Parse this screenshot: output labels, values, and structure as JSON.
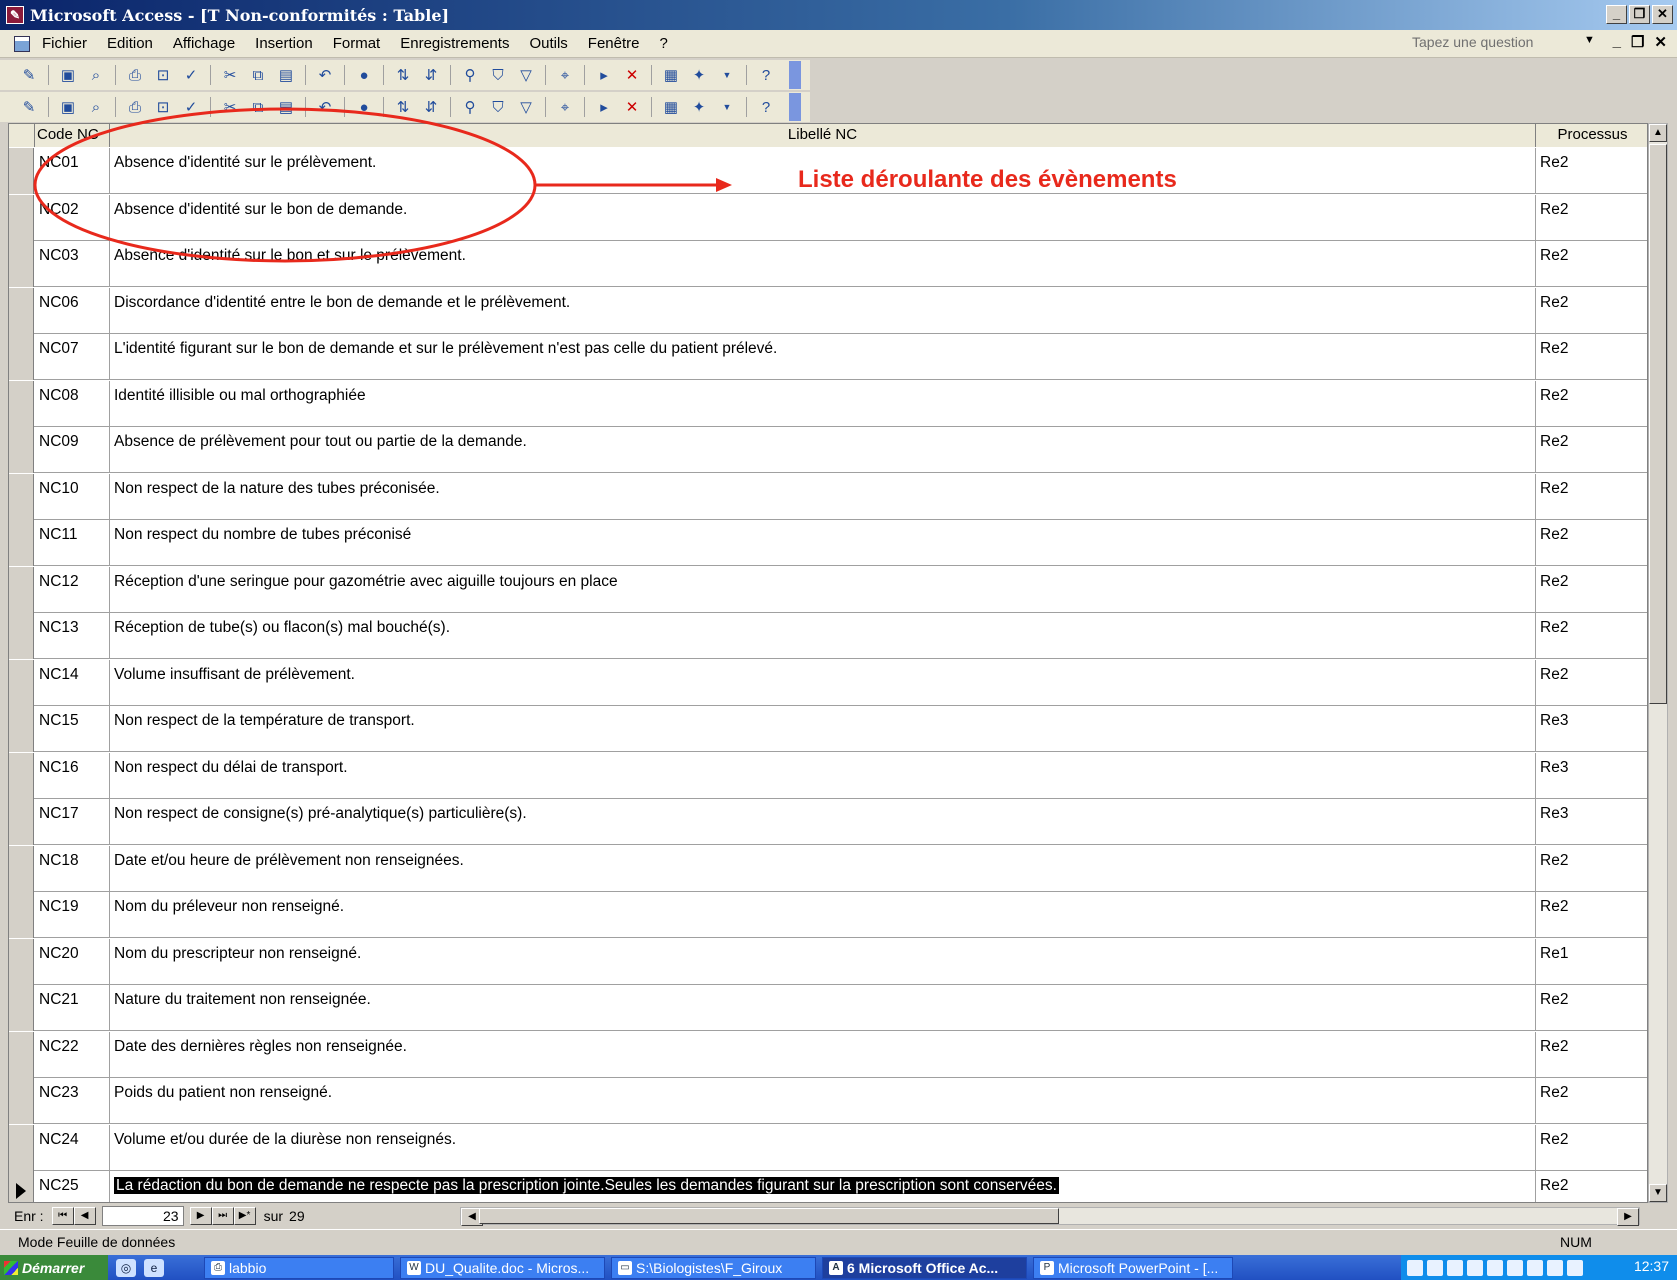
{
  "window": {
    "title": "Microsoft Access - [T Non-conformités : Table]",
    "minimize": "_",
    "restore": "❐",
    "close": "✕"
  },
  "menu": {
    "items": [
      "Fichier",
      "Edition",
      "Affichage",
      "Insertion",
      "Format",
      "Enregistrements",
      "Outils",
      "Fenêtre",
      "?"
    ],
    "ask_placeholder": "Tapez une question"
  },
  "table": {
    "columns": [
      "Code NC",
      "Libellé NC",
      "Processus"
    ],
    "rows": [
      {
        "code": "NC01",
        "libelle": "Absence d'identité sur le prélèvement.",
        "processus": "Re2"
      },
      {
        "code": "NC02",
        "libelle": "Absence d'identité sur le bon de demande.",
        "processus": "Re2"
      },
      {
        "code": "NC03",
        "libelle": "Absence d'identité sur le bon et sur le prélèvement.",
        "processus": "Re2"
      },
      {
        "code": "NC06",
        "libelle": "Discordance d'identité entre le bon de demande et le prélèvement.",
        "processus": "Re2"
      },
      {
        "code": "NC07",
        "libelle": "L'identité figurant sur le bon de demande et sur le prélèvement n'est pas celle du patient prélevé.",
        "processus": "Re2"
      },
      {
        "code": "NC08",
        "libelle": "Identité illisible ou mal orthographiée",
        "processus": "Re2"
      },
      {
        "code": "NC09",
        "libelle": "Absence de prélèvement pour tout ou partie de la demande.",
        "processus": "Re2"
      },
      {
        "code": "NC10",
        "libelle": "Non respect de la nature des tubes préconisée.",
        "processus": "Re2"
      },
      {
        "code": "NC11",
        "libelle": "Non respect du nombre de tubes préconisé",
        "processus": "Re2"
      },
      {
        "code": "NC12",
        "libelle": "Réception d'une seringue pour gazométrie avec aiguille toujours en place",
        "processus": "Re2"
      },
      {
        "code": "NC13",
        "libelle": "Réception de tube(s) ou flacon(s) mal bouché(s).",
        "processus": "Re2"
      },
      {
        "code": "NC14",
        "libelle": "Volume insuffisant de prélèvement.",
        "processus": "Re2"
      },
      {
        "code": "NC15",
        "libelle": "Non respect de la température de transport.",
        "processus": "Re3"
      },
      {
        "code": "NC16",
        "libelle": "Non respect du délai de transport.",
        "processus": "Re3"
      },
      {
        "code": "NC17",
        "libelle": "Non respect de consigne(s) pré-analytique(s) particulière(s).",
        "processus": "Re3"
      },
      {
        "code": "NC18",
        "libelle": "Date et/ou heure de prélèvement non renseignées.",
        "processus": "Re2"
      },
      {
        "code": "NC19",
        "libelle": "Nom du préleveur non renseigné.",
        "processus": "Re2"
      },
      {
        "code": "NC20",
        "libelle": "Nom du prescripteur non renseigné.",
        "processus": "Re1"
      },
      {
        "code": "NC21",
        "libelle": "Nature du traitement non renseignée.",
        "processus": "Re2"
      },
      {
        "code": "NC22",
        "libelle": "Date des dernières règles non renseignée.",
        "processus": "Re2"
      },
      {
        "code": "NC23",
        "libelle": "Poids du patient non renseigné.",
        "processus": "Re2"
      },
      {
        "code": "NC24",
        "libelle": "Volume et/ou durée de la diurèse non renseignés.",
        "processus": "Re2"
      },
      {
        "code": "NC25",
        "libelle": "La rédaction du bon de demande ne respecte pas la prescription jointe.Seules les demandes figurant sur la prescription sont conservées.",
        "processus": "Re2"
      }
    ],
    "current_row_index": 22
  },
  "navigation": {
    "label": "Enr :",
    "current": "23",
    "of_label": "sur",
    "total": "29"
  },
  "status": {
    "mode": "Mode Feuille de données",
    "num": "NUM"
  },
  "taskbar": {
    "start": "Démarrer",
    "tasks": [
      {
        "label": "labbio",
        "active": false
      },
      {
        "label": "DU_Qualite.doc - Micros...",
        "active": false
      },
      {
        "label": "S:\\Biologistes\\F_Giroux",
        "active": false
      },
      {
        "label": "6 Microsoft Office Ac...",
        "active": true
      },
      {
        "label": "Microsoft PowerPoint - [...",
        "active": false
      }
    ],
    "clock": "12:37"
  },
  "annotation": {
    "label": "Liste déroulante des évènements",
    "color": "#e8291c"
  }
}
